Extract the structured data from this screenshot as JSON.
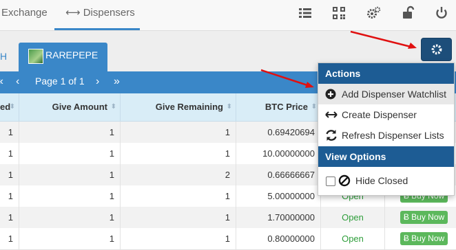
{
  "nav": {
    "exchange_label": "Exchange",
    "dispensers_label": "Dispensers",
    "icons": [
      "list-icon",
      "qrcode-icon",
      "cogs-icon",
      "unlock-icon",
      "power-icon"
    ]
  },
  "tabs": {
    "partial_label": "H",
    "active_label": "RAREPEPE"
  },
  "pager": {
    "first": "«",
    "prev": "‹",
    "text": "Page 1 of 1",
    "next": "›",
    "last": "»"
  },
  "table": {
    "columns": [
      "ed",
      "Give Amount",
      "Give Remaining",
      "BTC Price"
    ],
    "sort_icon": "⬍",
    "rows": [
      {
        "c0": "1",
        "give_amount": "1",
        "give_remaining": "1",
        "btc_price": "0.69420694",
        "status": "",
        "buy": ""
      },
      {
        "c0": "1",
        "give_amount": "1",
        "give_remaining": "1",
        "btc_price": "10.00000000",
        "status": "",
        "buy": ""
      },
      {
        "c0": "1",
        "give_amount": "1",
        "give_remaining": "2",
        "btc_price": "0.66666667",
        "status": "",
        "buy": ""
      },
      {
        "c0": "1",
        "give_amount": "1",
        "give_remaining": "1",
        "btc_price": "5.00000000",
        "status": "Open",
        "buy": "Buy Now"
      },
      {
        "c0": "1",
        "give_amount": "1",
        "give_remaining": "1",
        "btc_price": "1.70000000",
        "status": "Open",
        "buy": "Buy Now"
      },
      {
        "c0": "1",
        "give_amount": "1",
        "give_remaining": "1",
        "btc_price": "0.80000000",
        "status": "Open",
        "buy": "Buy Now"
      }
    ]
  },
  "dropdown": {
    "actions_header": "Actions",
    "items": [
      {
        "label": "Add Dispenser Watchlist",
        "icon": "plus-circle-icon"
      },
      {
        "label": "Create Dispenser",
        "icon": "arrows-h-icon"
      },
      {
        "label": "Refresh Dispenser Lists",
        "icon": "refresh-icon"
      }
    ],
    "view_header": "View Options",
    "hide_closed_label": "Hide Closed"
  },
  "colors": {
    "primary": "#3a87c8",
    "dark_primary": "#1d5c94",
    "open_green": "#2e9e3a",
    "buy_button": "#5cb85c",
    "annotation_red": "#e01010"
  }
}
